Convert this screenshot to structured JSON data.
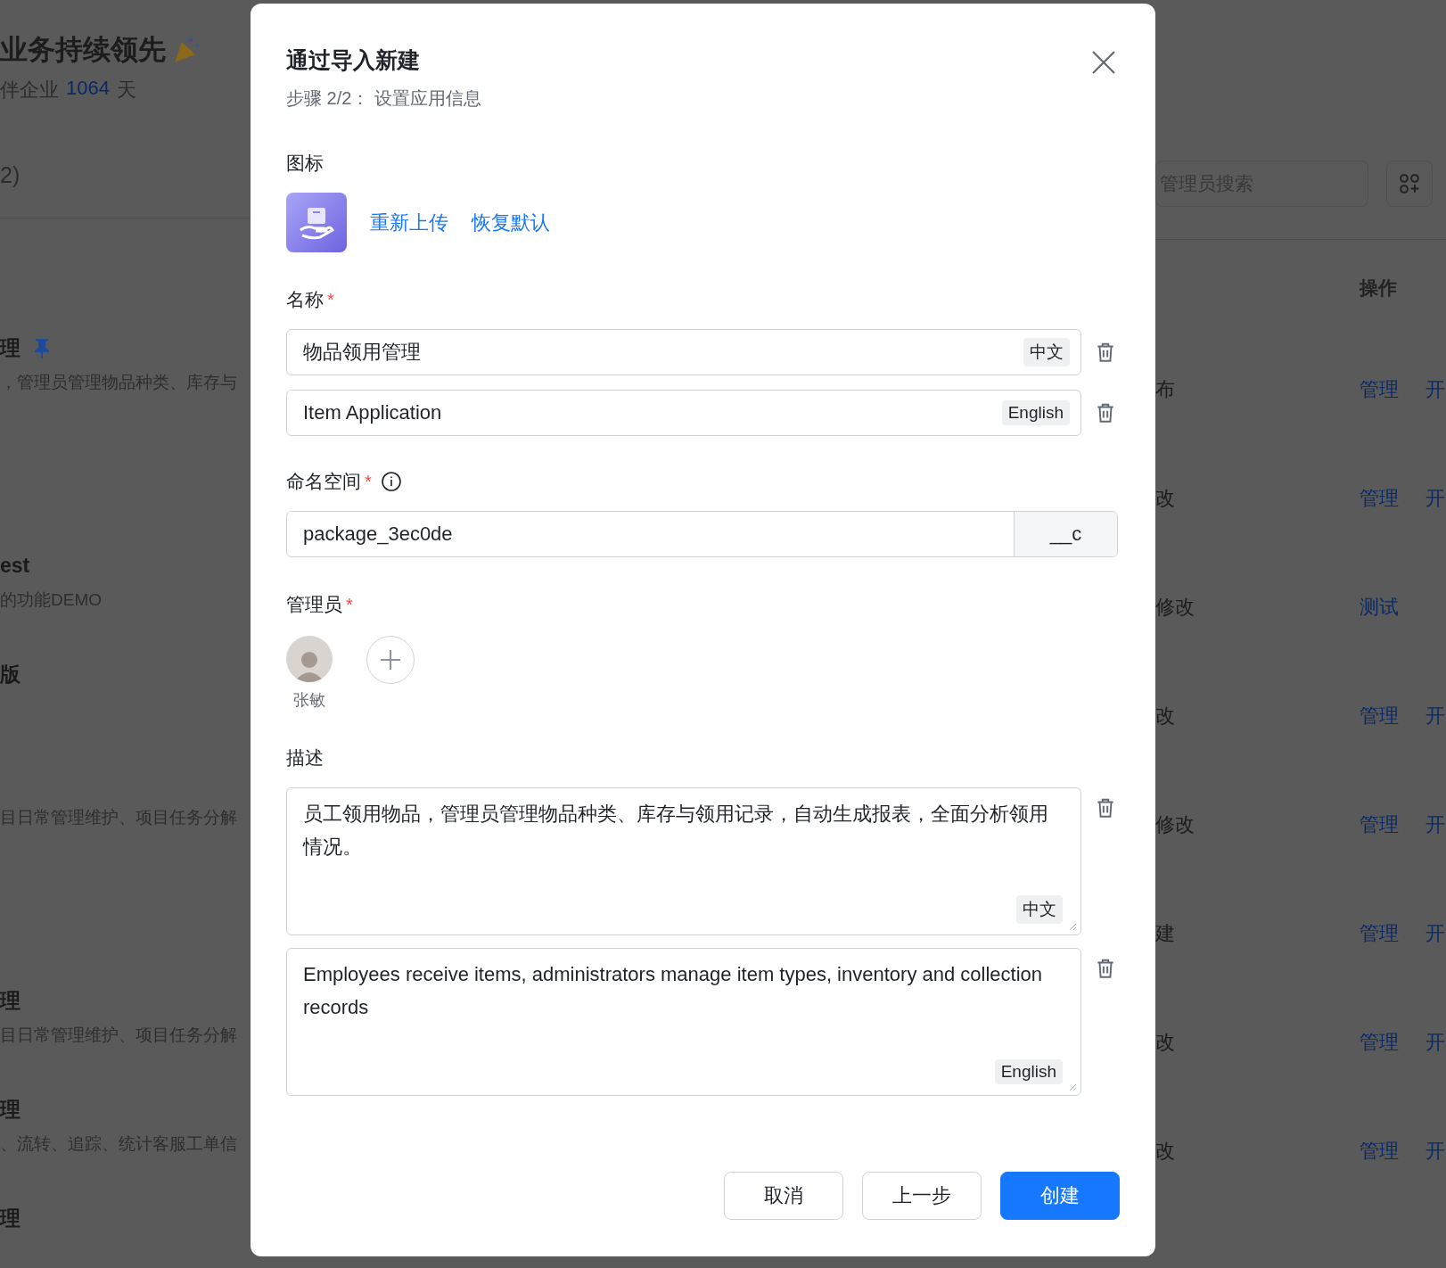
{
  "background": {
    "header_title": "业务持续领先",
    "header_subtitle_prefix": "伴企业",
    "header_days": "1064",
    "header_subtitle_suffix": "天",
    "count_fragment": "2)",
    "search": {
      "placeholder": "管理员搜索"
    },
    "ops_header": "操作",
    "left_rows": [
      {
        "name": "理",
        "pinned": true,
        "desc": "，管理员管理物品种类、库存与"
      },
      {},
      {
        "name": "est",
        "desc": "的功能DEMO"
      },
      {
        "name": "版"
      },
      {
        "desc": "目日常管理维护、项目任务分解"
      },
      {},
      {
        "name": "理",
        "desc": "目日常管理维护、项目任务分解"
      },
      {
        "name": "理",
        "desc": "、流转、追踪、统计客服工单信"
      },
      {
        "name": "理"
      }
    ],
    "right_rows": [
      {
        "status": "布",
        "ops": [
          "管理",
          "开"
        ]
      },
      {
        "status": "改",
        "ops": [
          "管理",
          "开"
        ]
      },
      {
        "status": "修改",
        "ops": [
          "测试"
        ]
      },
      {
        "status": "改",
        "ops": [
          "管理",
          "开"
        ]
      },
      {
        "status": "修改",
        "ops": [
          "管理",
          "开"
        ]
      },
      {
        "status": "建",
        "ops": [
          "管理",
          "开"
        ]
      },
      {
        "status": "改",
        "ops": [
          "管理",
          "开"
        ]
      },
      {
        "status": "改",
        "ops": [
          "管理",
          "开"
        ]
      }
    ]
  },
  "dialog": {
    "required_mark": "*",
    "title": "通过导入新建",
    "subtitle": "步骤 2/2： 设置应用信息",
    "icon_label": "图标",
    "icon_actions": [
      "重新上传",
      "恢复默认"
    ],
    "name_label": "名称",
    "name_required": true,
    "names": [
      {
        "value": "物品领用管理",
        "tag": "中文"
      },
      {
        "value": "Item Application",
        "tag": "English"
      }
    ],
    "namespace_label": "命名空间",
    "namespace_required": true,
    "namespace_value": "package_3ec0de",
    "namespace_suffix": "__c",
    "admin_label": "管理员",
    "admin_required": true,
    "admins": [
      {
        "name": "张敏"
      }
    ],
    "desc_label": "描述",
    "descriptions": [
      {
        "value": "员工领用物品，管理员管理物品种类、库存与领用记录，自动生成报表，全面分析领用情况。",
        "tag": "中文"
      },
      {
        "value": "Employees receive items, administrators manage item types, inventory and collection records",
        "tag": "English"
      }
    ],
    "buttons": [
      {
        "label": "取消",
        "kind": "default"
      },
      {
        "label": "上一步",
        "kind": "default"
      },
      {
        "label": "创建",
        "kind": "primary"
      }
    ]
  }
}
